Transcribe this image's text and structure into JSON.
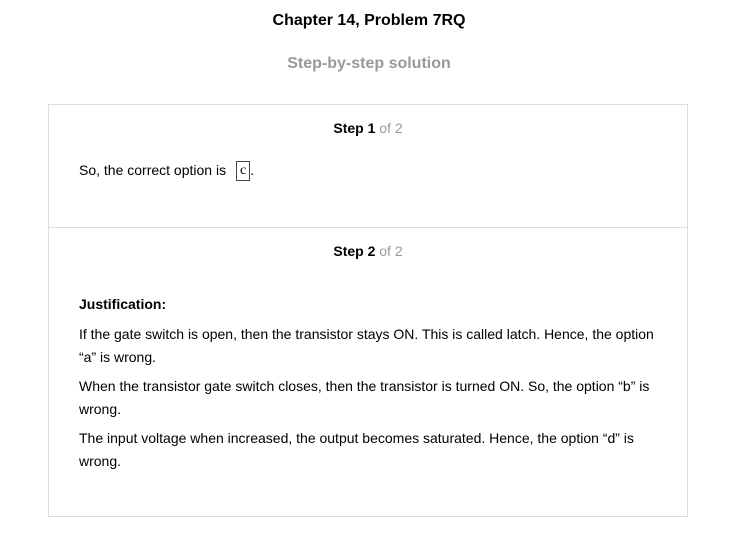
{
  "header": {
    "title": "Chapter 14, Problem 7RQ",
    "subtitle": "Step-by-step solution"
  },
  "steps": [
    {
      "label": "Step 1",
      "of": "of 2",
      "text": "So, the correct option is",
      "answer": "c",
      "punct": "."
    },
    {
      "label": "Step 2",
      "of": "of 2",
      "heading": "Justification:",
      "paragraphs": [
        "If the gate switch is open, then the transistor stays ON. This is called latch. Hence, the option “a” is wrong.",
        "When the transistor gate switch closes, then the transistor is turned ON. So, the option “b” is wrong.",
        "The input voltage when increased, the output becomes saturated. Hence, the option “d” is wrong."
      ]
    }
  ]
}
